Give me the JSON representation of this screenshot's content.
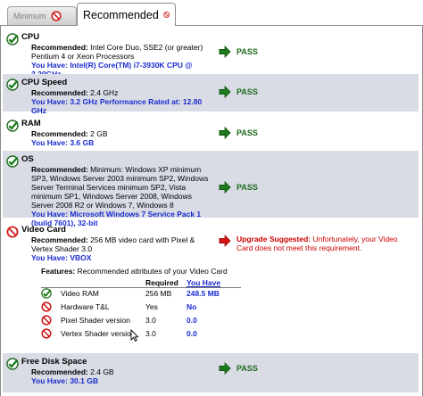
{
  "tabs": {
    "minimum": "Minimum",
    "recommended": "Recommended"
  },
  "labels": {
    "recommended": "Recommended:",
    "you_have": "You Have:",
    "pass": "PASS",
    "upgrade": "Upgrade Suggested:"
  },
  "rows": {
    "cpu": {
      "title": "CPU",
      "recommended": "Intel Core Duo, SSE2 (or greater) Pentium 4 or Xeon Processors",
      "you_have": "Intel(R) Core(TM) i7-3930K CPU @ 3.20GHz",
      "status": "pass"
    },
    "cpu_speed": {
      "title": "CPU Speed",
      "recommended": "2.4 GHz",
      "you_have": "3.2 GHz Performance Rated at: 12.80 GHz",
      "status": "pass"
    },
    "ram": {
      "title": "RAM",
      "recommended": "2 GB",
      "you_have": "3.6 GB",
      "status": "pass"
    },
    "os": {
      "title": "OS",
      "recommended": "Minimum: Windows XP minimum SP3, Windows Server 2003 minimum SP2, Windows Server Terminal Services minimum SP2, Vista minimum SP1, Windows Server 2008, Windows Server 2008 R2 or Windows 7, Windows 8",
      "you_have": "Microsoft Windows 7 Service Pack 1 (build 7601), 32-bit",
      "status": "pass"
    },
    "video": {
      "title": "Video Card",
      "recommended": "256 MB video card with Pixel & Vertex Shader 3.0",
      "you_have": "VBOX",
      "status": "fail",
      "message": "Unfortunately, your Video Card does not meet this requirement."
    },
    "disk": {
      "title": "Free Disk Space",
      "recommended": "2.4 GB",
      "you_have": "30.1 GB",
      "status": "pass"
    }
  },
  "features": {
    "heading_bold": "Features:",
    "heading_rest": "Recommended attributes of your Video Card",
    "col_required": "Required",
    "col_you_have": "You Have",
    "items": [
      {
        "name": "Video RAM",
        "required": "256 MB",
        "you_have": "248.5 MB",
        "status": "pass"
      },
      {
        "name": "Hardware T&L",
        "required": "Yes",
        "you_have": "No",
        "status": "fail"
      },
      {
        "name": "Pixel Shader version",
        "required": "3.0",
        "you_have": "0.0",
        "status": "fail"
      },
      {
        "name": "Vertex Shader version",
        "required": "3.0",
        "you_have": "0.0",
        "status": "fail"
      }
    ]
  },
  "colors": {
    "shade": "#d9dce5",
    "pass_green": "#1f6b1f",
    "have_blue": "#1a2bcf",
    "fail_red": "#cc0000"
  }
}
